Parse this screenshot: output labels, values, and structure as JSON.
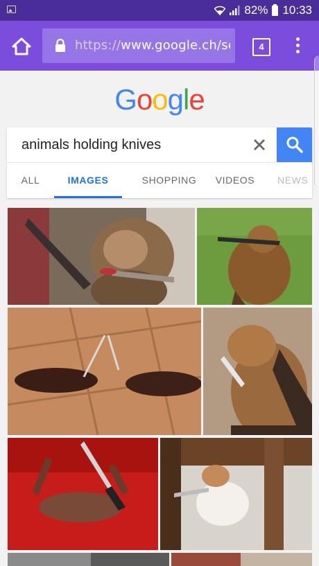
{
  "status_bar": {
    "battery_percent": "82%",
    "time": "10:33"
  },
  "browser": {
    "url_scheme": "https://",
    "url_rest": "www.google.ch/searc",
    "tab_count": "4"
  },
  "logo": {
    "letters": [
      "G",
      "o",
      "o",
      "g",
      "l",
      "e"
    ],
    "colors": [
      "#4285f4",
      "#ea4335",
      "#fbbc05",
      "#4285f4",
      "#34a853",
      "#ea4335"
    ]
  },
  "search": {
    "query": "animals holding knives"
  },
  "tabs": [
    "ALL",
    "IMAGES",
    "SHOPPING",
    "VIDEOS",
    "NEWS"
  ],
  "active_tab": "IMAGES",
  "accent_color": "#1a73e8",
  "toolbar_color": "#7c4ddd",
  "status_bar_color": "#4a2d99"
}
